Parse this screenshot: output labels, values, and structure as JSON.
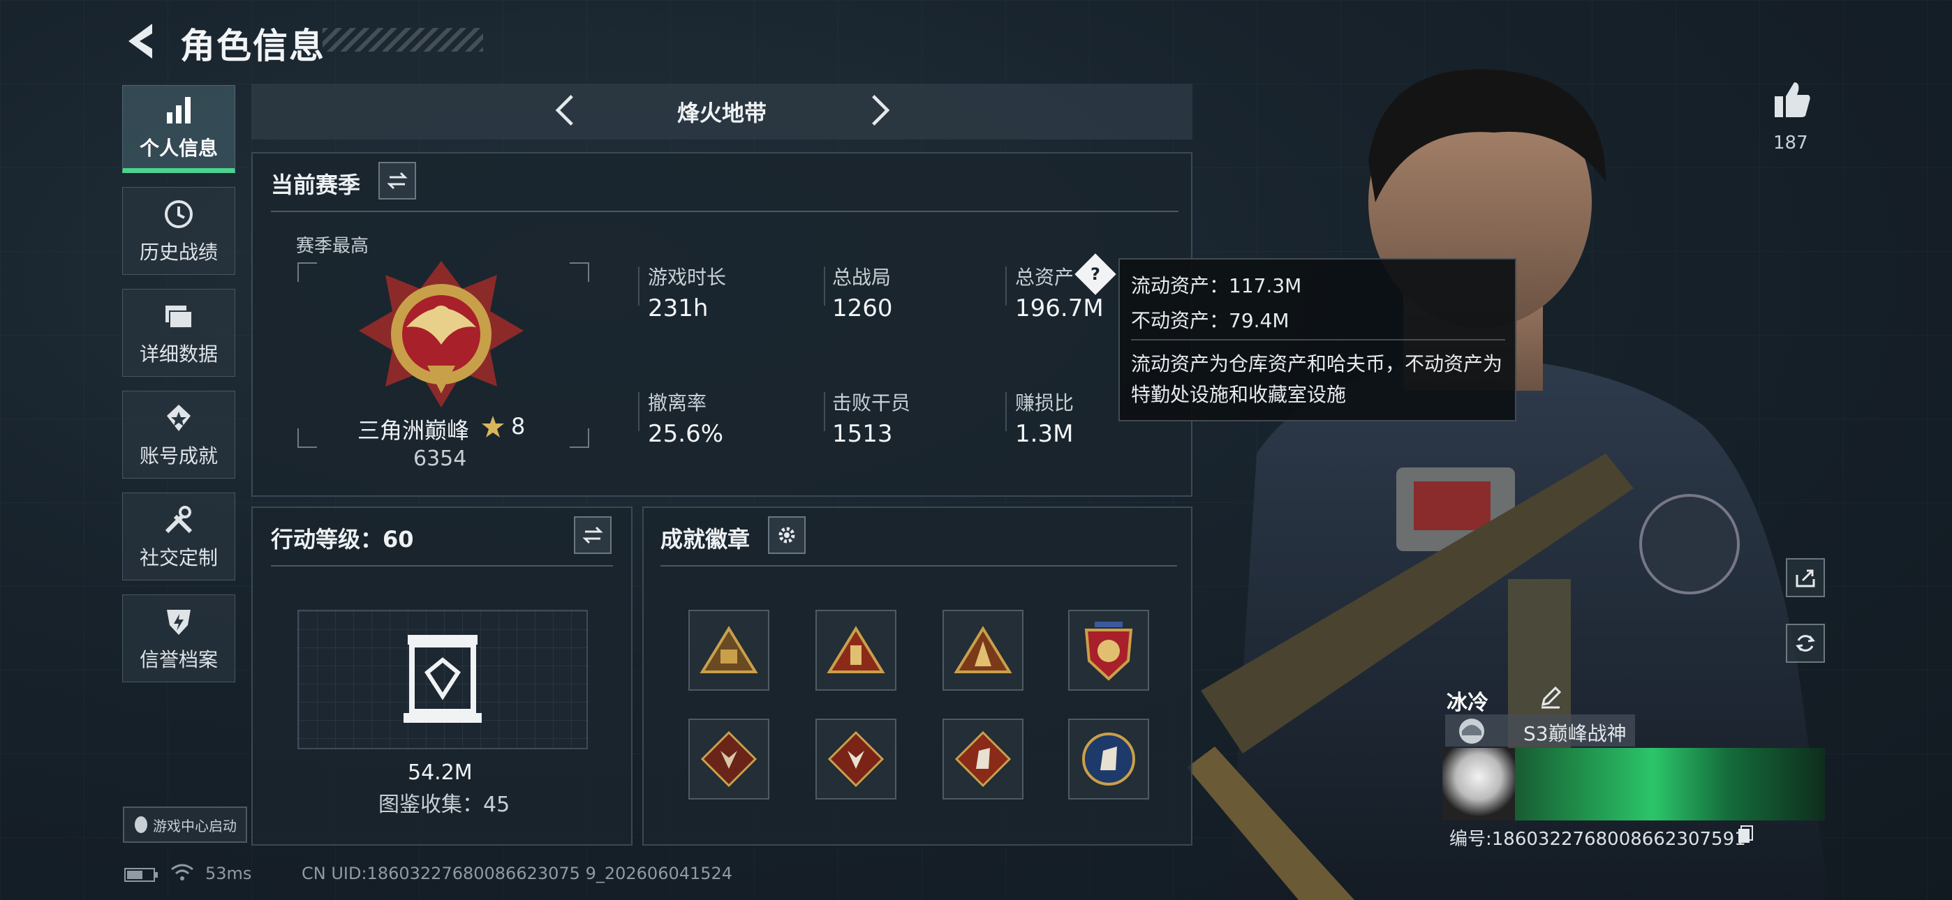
{
  "header": {
    "title": "角色信息"
  },
  "sidebar": {
    "items": [
      {
        "label": "个人信息",
        "icon": "bar-chart-icon",
        "active": true
      },
      {
        "label": "历史战绩",
        "icon": "history-icon"
      },
      {
        "label": "详细数据",
        "icon": "folder-icon"
      },
      {
        "label": "账号成就",
        "icon": "medal-icon"
      },
      {
        "label": "社交定制",
        "icon": "tools-icon"
      },
      {
        "label": "信誉档案",
        "icon": "shield-icon"
      }
    ],
    "game_center_label": "游戏中心启动"
  },
  "mode_selector": {
    "label": "烽火地带"
  },
  "current_season": {
    "title": "当前赛季",
    "rank_caption": "赛季最高",
    "rank_name": "三角洲巅峰",
    "rank_stars": "8",
    "rank_score": "6354",
    "stats": [
      {
        "label": "游戏时长",
        "value": "231h"
      },
      {
        "label": "总战局",
        "value": "1260"
      },
      {
        "label": "总资产",
        "value": "196.7M"
      },
      {
        "label": "撤离率",
        "value": "25.6%"
      },
      {
        "label": "击败干员",
        "value": "1513"
      },
      {
        "label": "赚损比",
        "value": "1.3M"
      }
    ]
  },
  "asset_tooltip": {
    "liquid": "流动资产：117.3M",
    "fixed": "不动资产：79.4M",
    "description": "流动资产为仓库资产和哈夫币，不动资产为特勤处设施和收藏室设施"
  },
  "action_level": {
    "title": "行动等级：60",
    "value": "54.2M",
    "collection": "图鉴收集：45"
  },
  "badges": {
    "title": "成就徽章"
  },
  "likes": {
    "count": "187"
  },
  "player_card": {
    "name": "冰冷",
    "title": "S3巅峰战神",
    "id": "编号:1860322768008662307591"
  },
  "footer": {
    "ping": "53ms",
    "uid": "CN UID:18603227680086623075 9_202606041524"
  },
  "colors": {
    "accent_green": "#4cd38f",
    "gold": "#c9a04a"
  }
}
